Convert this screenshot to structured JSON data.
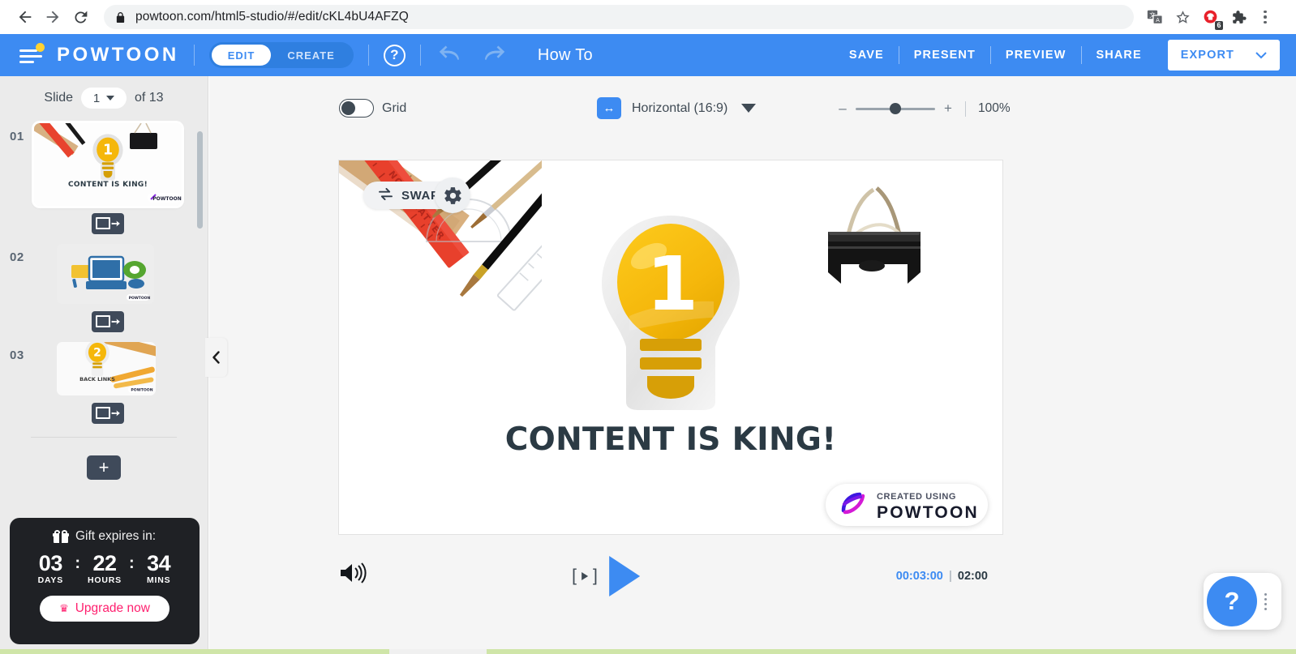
{
  "browser": {
    "url": "powtoon.com/html5-studio/#/edit/cKL4bU4AFZQ",
    "back_label": "Back",
    "forward_label": "Forward",
    "reload_label": "Reload",
    "lock_label": "Secure connection",
    "translate_label": "Translate this page",
    "bookmark_label": "Bookmark this tab",
    "extension_badge": "6",
    "extensions_label": "Extensions",
    "menu_label": "Customize and control Google Chrome"
  },
  "header": {
    "brand": "POWTOON",
    "mode_edit": "EDIT",
    "mode_create": "CREATE",
    "help": "?",
    "undo_label": "Undo",
    "redo_label": "Redo",
    "doc_title": "How To",
    "actions": [
      "SAVE",
      "PRESENT",
      "PREVIEW",
      "SHARE"
    ],
    "export_label": "EXPORT",
    "accent_color": "#3d8bf2"
  },
  "sidebar": {
    "slide_word": "Slide",
    "slide_current": "1",
    "of_text": "of 13",
    "slides": [
      {
        "index": "01",
        "title": "CONTENT IS KING!",
        "selected": true
      },
      {
        "index": "02",
        "title": "",
        "selected": false
      },
      {
        "index": "03",
        "title": "BACK LINKS",
        "selected": false
      }
    ],
    "add_slide_label": "+",
    "transition_label": "Transition"
  },
  "gift": {
    "title": "Gift expires in:",
    "days_value": "03",
    "days_label": "DAYS",
    "hours_value": "22",
    "hours_label": "HOURS",
    "mins_value": "34",
    "mins_label": "MINS",
    "upgrade_label": "Upgrade now",
    "upgrade_color": "#ff1f6e"
  },
  "toolbar": {
    "grid_label": "Grid",
    "grid_on": false,
    "ratio_label": "Horizontal (16:9)",
    "zoom_minus": "–",
    "zoom_plus": "+",
    "zoom_value": "100%"
  },
  "canvas": {
    "swap_label": "SWAP",
    "settings_label": "Settings",
    "bulb_number": "1",
    "title": "CONTENT IS KING!",
    "watermark_top": "CREATED USING",
    "watermark_main": "POWTOON",
    "ruler_text": "NON-SHATTER"
  },
  "playback": {
    "volume_label": "Volume",
    "step_label": "Step forward",
    "play_label": "Play",
    "current_time": "00:03:00",
    "time_divider": "|",
    "total_time": "02:00"
  },
  "help_fab": {
    "label": "?",
    "more_label": "More options"
  }
}
